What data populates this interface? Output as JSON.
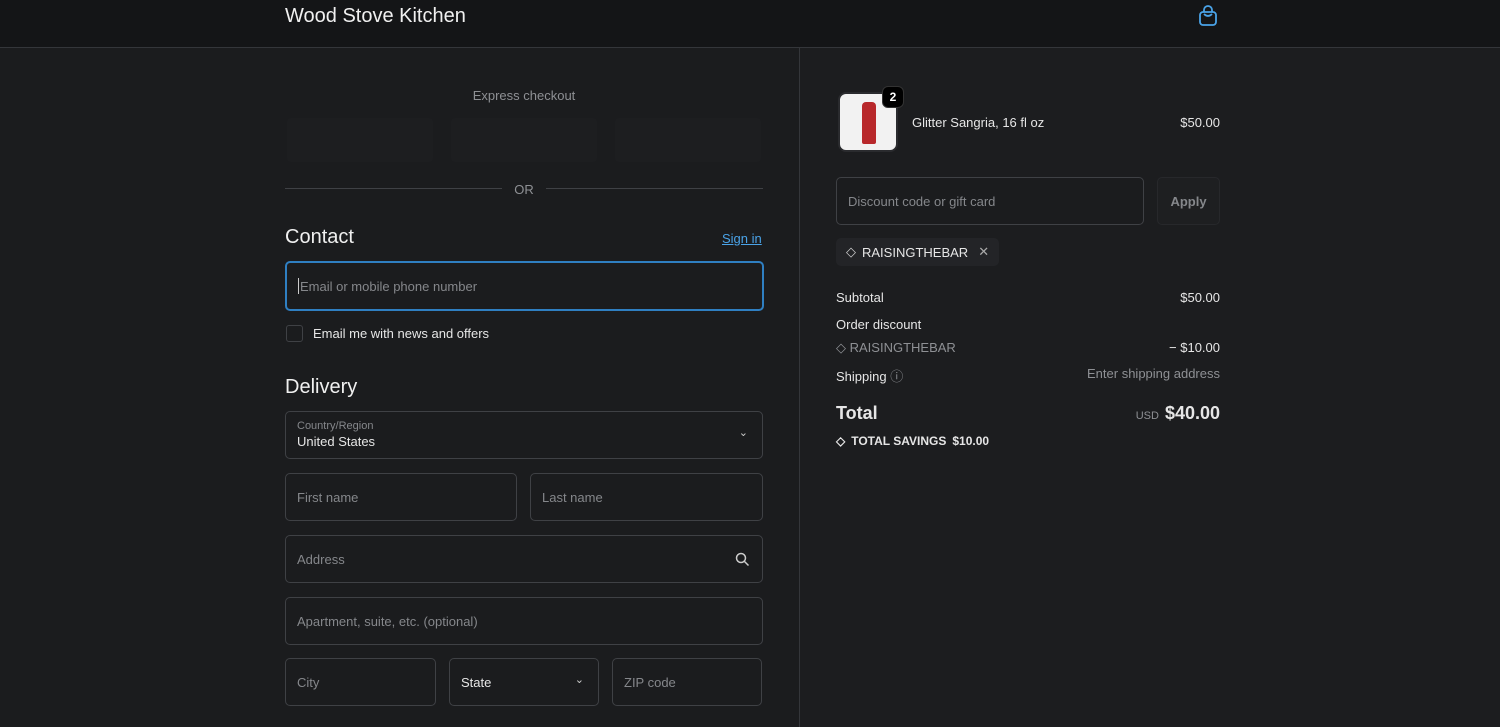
{
  "header": {
    "brand": "Wood Stove Kitchen",
    "cart_icon": "shopping-bag-icon"
  },
  "express": {
    "label": "Express checkout",
    "or": "OR"
  },
  "contact": {
    "title": "Contact",
    "sign_in": "Sign in",
    "email_placeholder": "Email or mobile phone number",
    "newsletter": "Email me with news and offers"
  },
  "delivery": {
    "title": "Delivery",
    "country_label": "Country/Region",
    "country_value": "United States",
    "first_name": "First name",
    "last_name": "Last name",
    "address": "Address",
    "apartment": "Apartment, suite, etc. (optional)",
    "city": "City",
    "state": "State",
    "zip": "ZIP code"
  },
  "cart": {
    "item_name": "Glitter Sangria, 16 fl oz",
    "item_price": "$50.00",
    "quantity": "2"
  },
  "discount": {
    "placeholder": "Discount code or gift card",
    "apply": "Apply",
    "applied_code": "RAISINGTHEBAR"
  },
  "summary": {
    "subtotal_label": "Subtotal",
    "subtotal": "$50.00",
    "order_discount_label": "Order discount",
    "discount_code": "RAISINGTHEBAR",
    "discount_amount": "− $10.00",
    "shipping_label": "Shipping",
    "shipping_value": "Enter shipping address",
    "total_label": "Total",
    "currency": "USD",
    "total": "$40.00",
    "savings_label": "TOTAL SAVINGS",
    "savings": "$10.00"
  }
}
